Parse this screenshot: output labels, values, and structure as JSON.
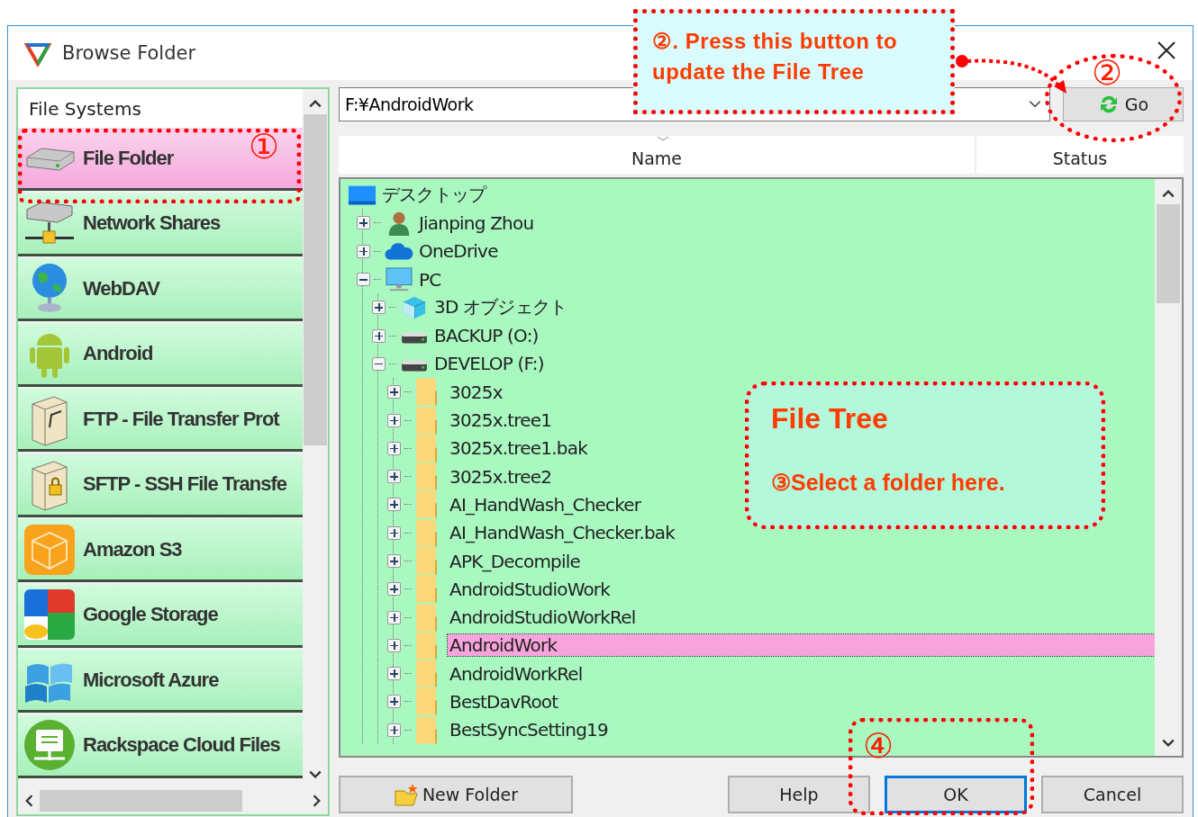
{
  "window": {
    "title": "Browse Folder"
  },
  "sidebar": {
    "header": "File Systems",
    "items": [
      {
        "label": "File Folder",
        "kind": "drive",
        "selected": true
      },
      {
        "label": "Network Shares",
        "kind": "network",
        "selected": false
      },
      {
        "label": "WebDAV",
        "kind": "globe",
        "selected": false
      },
      {
        "label": "Android",
        "kind": "android",
        "selected": false
      },
      {
        "label": "FTP - File Transfer Prot",
        "kind": "server",
        "selected": false
      },
      {
        "label": "SFTP - SSH File Transfe",
        "kind": "server-lock",
        "selected": false
      },
      {
        "label": "Amazon S3",
        "kind": "cube",
        "selected": false
      },
      {
        "label": "Google Storage",
        "kind": "squares",
        "selected": false
      },
      {
        "label": "Microsoft Azure",
        "kind": "flag",
        "selected": false
      },
      {
        "label": "Rackspace Cloud Files",
        "kind": "board",
        "selected": false
      }
    ]
  },
  "path_field": {
    "value": "F:¥AndroidWork"
  },
  "go_button": {
    "label": "Go"
  },
  "columns": [
    "Name",
    "Status"
  ],
  "tree": [
    {
      "label": "デスクトップ",
      "kind": "desktop",
      "selected": false,
      "children": [
        {
          "label": "Jianping Zhou",
          "kind": "user",
          "expanded": false,
          "selected": false
        },
        {
          "label": "OneDrive",
          "kind": "cloud",
          "expanded": false,
          "selected": false
        },
        {
          "label": "PC",
          "kind": "pc",
          "expanded": true,
          "selected": false,
          "children": [
            {
              "label": "3D オブジェクト",
              "kind": "cube",
              "expanded": false,
              "selected": false
            },
            {
              "label": "BACKUP (O:)",
              "kind": "drive",
              "expanded": false,
              "selected": false
            },
            {
              "label": "DEVELOP (F:)",
              "kind": "drive",
              "expanded": true,
              "selected": false,
              "children": [
                {
                  "label": "3025x",
                  "kind": "folder",
                  "expanded": false,
                  "selected": false
                },
                {
                  "label": "3025x.tree1",
                  "kind": "folder",
                  "expanded": false,
                  "selected": false
                },
                {
                  "label": "3025x.tree1.bak",
                  "kind": "folder",
                  "expanded": false,
                  "selected": false
                },
                {
                  "label": "3025x.tree2",
                  "kind": "folder",
                  "expanded": false,
                  "selected": false
                },
                {
                  "label": "AI_HandWash_Checker",
                  "kind": "folder",
                  "expanded": false,
                  "selected": false
                },
                {
                  "label": "AI_HandWash_Checker.bak",
                  "kind": "folder",
                  "expanded": false,
                  "selected": false
                },
                {
                  "label": "APK_Decompile",
                  "kind": "folder",
                  "expanded": false,
                  "selected": false
                },
                {
                  "label": "AndroidStudioWork",
                  "kind": "folder",
                  "expanded": false,
                  "selected": false
                },
                {
                  "label": "AndroidStudioWorkRel",
                  "kind": "folder",
                  "expanded": false,
                  "selected": false
                },
                {
                  "label": "AndroidWork",
                  "kind": "folder",
                  "expanded": false,
                  "selected": true
                },
                {
                  "label": "AndroidWorkRel",
                  "kind": "folder",
                  "expanded": false,
                  "selected": false
                },
                {
                  "label": "BestDavRoot",
                  "kind": "folder",
                  "expanded": false,
                  "selected": false
                },
                {
                  "label": "BestSyncSetting19",
                  "kind": "folder",
                  "expanded": false,
                  "selected": false
                }
              ]
            }
          ]
        }
      ]
    }
  ],
  "buttons": [
    {
      "label": "New Folder",
      "kind": "new-folder",
      "default": false
    },
    {
      "label": "Help",
      "kind": "plain",
      "default": false
    },
    {
      "label": "OK",
      "kind": "plain",
      "default": true
    },
    {
      "label": "Cancel",
      "kind": "plain",
      "default": false
    }
  ],
  "annotations": [
    {
      "kind": "box",
      "lines": [
        "②. Press this button to",
        "update the File  Tree"
      ]
    },
    {
      "kind": "marker",
      "text": "②"
    },
    {
      "kind": "marker",
      "text": "①"
    },
    {
      "kind": "note",
      "title": "File Tree",
      "text": "③Select a folder here."
    },
    {
      "kind": "marker",
      "text": "④"
    }
  ]
}
